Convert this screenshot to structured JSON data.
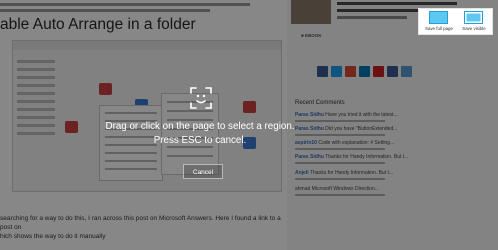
{
  "article": {
    "heading": "able Auto Arrange in a folder",
    "bottom_text_line1": "searching for a way to do this, I ran across this post on Microsoft Answers. Here I found a link to a post on",
    "bottom_text_line2": "hich shows the way to do it manually"
  },
  "sidebar": {
    "source_label": "■ EBOOK",
    "recent_heading": "Recent Comments",
    "comments": [
      {
        "name": "Paras Sidhu",
        "text": "Have you tried it with the latest..."
      },
      {
        "name": "Paras Sidhu",
        "text": "Did you have \"ButtonExtended..."
      },
      {
        "name": "aspirin10",
        "text": "Code with explanation: # Setting..."
      },
      {
        "name": "Paras Sidhu",
        "text": "Thanks for Handy Information. But I..."
      },
      {
        "name": "Anjeli",
        "text": "Thanks for Handy Information. But I..."
      },
      {
        "name": "",
        "text": "ahmad Microsoft Windows Direction..."
      }
    ],
    "share_colors": [
      "#3b5998",
      "#1da1f2",
      "#dd4b39",
      "#0077b5",
      "#ea4335",
      "#3b5998",
      "#5a9bd5"
    ]
  },
  "overlay": {
    "instruction": "Drag or click on the page to select a region. Press ESC to cancel.",
    "cancel_label": "Cancel"
  },
  "toolbar": {
    "save_full_page": "Save full page",
    "save_visible": "Save visible"
  },
  "colors": {
    "accent": "#1ba1e2",
    "overlay_dim": "rgba(0,0,0,0.47)"
  }
}
